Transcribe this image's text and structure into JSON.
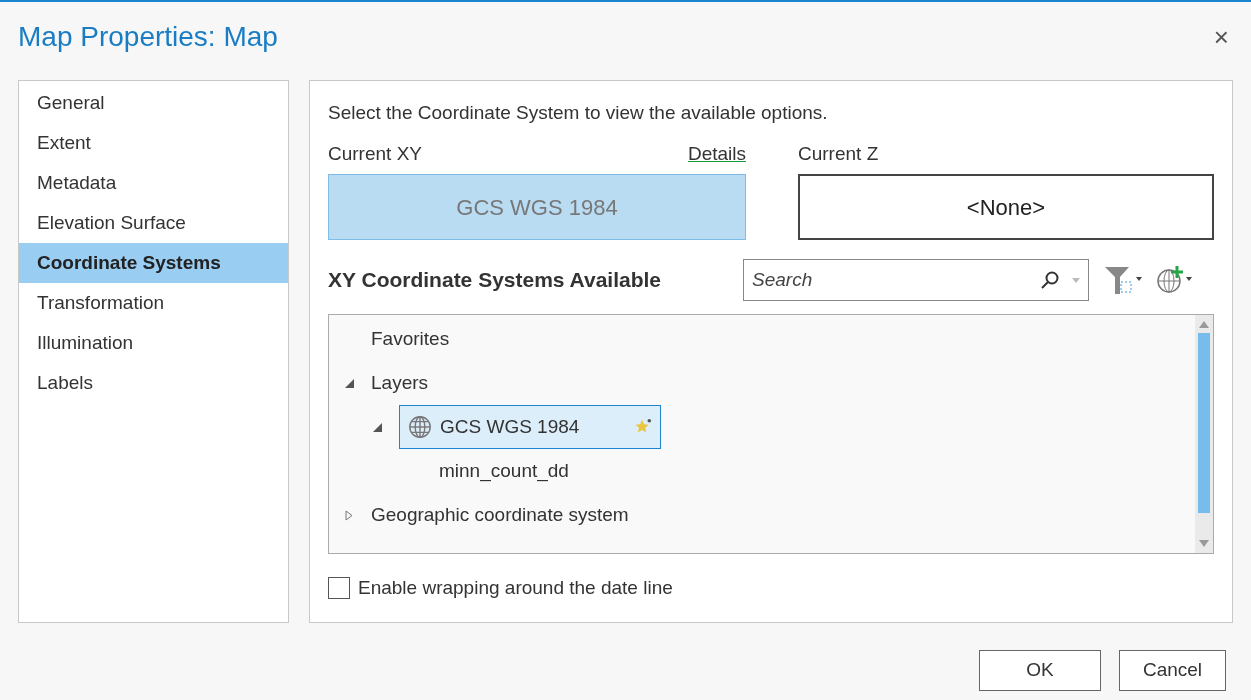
{
  "window": {
    "title": "Map Properties: Map",
    "close": "×"
  },
  "sidebar": {
    "items": [
      {
        "label": "General",
        "selected": false
      },
      {
        "label": "Extent",
        "selected": false
      },
      {
        "label": "Metadata",
        "selected": false
      },
      {
        "label": "Elevation Surface",
        "selected": false
      },
      {
        "label": "Coordinate Systems",
        "selected": true
      },
      {
        "label": "Transformation",
        "selected": false
      },
      {
        "label": "Illumination",
        "selected": false
      },
      {
        "label": "Labels",
        "selected": false
      }
    ]
  },
  "instructions": "Select the Coordinate System to view the available options.",
  "current_xy": {
    "label": "Current XY",
    "link": "Details",
    "value": "GCS WGS 1984"
  },
  "current_z": {
    "label": "Current Z",
    "value": "<None>"
  },
  "available": {
    "heading": "XY Coordinate Systems Available",
    "search": {
      "placeholder": "Search"
    }
  },
  "tree": [
    {
      "label": "Favorites",
      "kind": "folder"
    },
    {
      "label": "Layers",
      "kind": "folder",
      "expanded": true,
      "children": [
        {
          "label": "GCS WGS 1984",
          "kind": "coordinate-system",
          "expanded": true,
          "selected": true,
          "favorite": true,
          "children": [
            {
              "label": "minn_count_dd",
              "kind": "layer"
            }
          ]
        }
      ]
    },
    {
      "label": "Geographic coordinate system",
      "kind": "folder",
      "expanded": false
    }
  ],
  "wrap_checkbox": {
    "label": "Enable wrapping around the date line",
    "checked": false
  },
  "buttons": [
    {
      "label": "OK"
    },
    {
      "label": "Cancel"
    }
  ]
}
